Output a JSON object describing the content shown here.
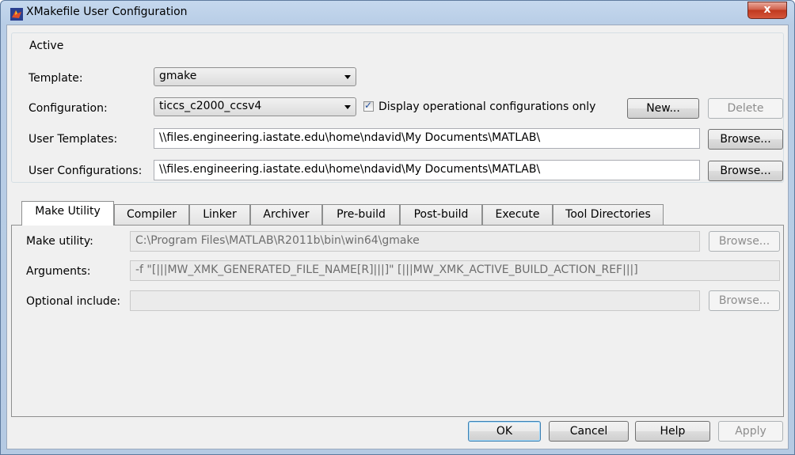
{
  "window": {
    "title": "XMakefile User Configuration",
    "close_label": "x"
  },
  "active_group": {
    "legend": "Active",
    "template_label": "Template:",
    "template_value": "gmake",
    "configuration_label": "Configuration:",
    "configuration_value": "ticcs_c2000_ccsv4",
    "display_operational_label": "Display operational configurations only",
    "display_operational_checked": true,
    "new_button": "New...",
    "delete_button": "Delete",
    "user_templates_label": "User Templates:",
    "user_templates_value": "\\\\files.engineering.iastate.edu\\home\\ndavid\\My Documents\\MATLAB\\",
    "user_templates_browse": "Browse...",
    "user_configurations_label": "User Configurations:",
    "user_configurations_value": "\\\\files.engineering.iastate.edu\\home\\ndavid\\My Documents\\MATLAB\\",
    "user_configurations_browse": "Browse..."
  },
  "tabs": [
    {
      "label": "Make Utility",
      "active": true
    },
    {
      "label": "Compiler",
      "active": false
    },
    {
      "label": "Linker",
      "active": false
    },
    {
      "label": "Archiver",
      "active": false
    },
    {
      "label": "Pre-build",
      "active": false
    },
    {
      "label": "Post-build",
      "active": false
    },
    {
      "label": "Execute",
      "active": false
    },
    {
      "label": "Tool Directories",
      "active": false
    }
  ],
  "make_utility": {
    "make_utility_label": "Make utility:",
    "make_utility_value": "C:\\Program Files\\MATLAB\\R2011b\\bin\\win64\\gmake",
    "make_utility_browse": "Browse...",
    "arguments_label": "Arguments:",
    "arguments_value": "-f \"[|||MW_XMK_GENERATED_FILE_NAME[R]|||]\" [|||MW_XMK_ACTIVE_BUILD_ACTION_REF|||]",
    "optional_include_label": "Optional include:",
    "optional_include_value": "",
    "optional_include_browse": "Browse..."
  },
  "footer": {
    "ok": "OK",
    "cancel": "Cancel",
    "help": "Help",
    "apply": "Apply"
  }
}
